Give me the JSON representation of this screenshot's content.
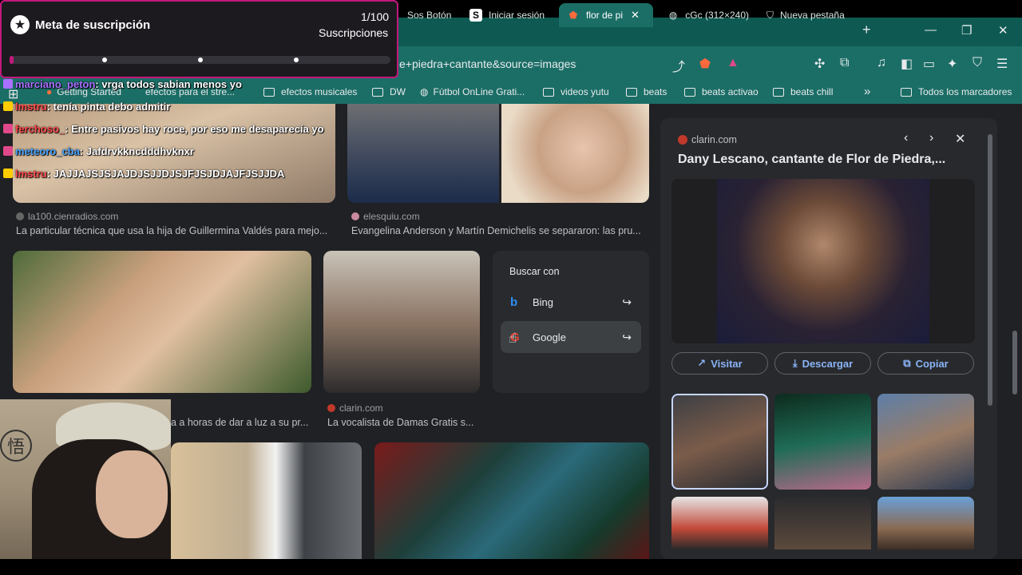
{
  "tabs": [
    {
      "label": "Sos Botón",
      "icon": "tab-favicon-icon"
    },
    {
      "label": "Iniciar sesión",
      "icon": "s-logo-icon"
    },
    {
      "label": "flor de pi",
      "icon": "brave-icon",
      "active": true
    },
    {
      "label": "cGc (312×240)",
      "icon": "globe-icon"
    },
    {
      "label": "Nueva pestaña",
      "icon": "shield-icon"
    }
  ],
  "window": {
    "new_tab": "+",
    "minimize": "—",
    "restore": "❐",
    "close": "✕"
  },
  "address": {
    "url": "e+piedra+cantante&source=images"
  },
  "bookmarks": [
    {
      "label": "Getting Started"
    },
    {
      "label": "efectos para el stre..."
    },
    {
      "label": "efectos musicales"
    },
    {
      "label": "DW"
    },
    {
      "label": "Fútbol OnLine Grati..."
    },
    {
      "label": "videos yutu"
    },
    {
      "label": "beats"
    },
    {
      "label": "beats activao"
    },
    {
      "label": "beats chill"
    },
    {
      "label": "Todos los marcadores"
    }
  ],
  "results": [
    {
      "source": "la100.cienradios.com",
      "caption": "La particular técnica que usa la hija de Guillermina Valdés para mejo..."
    },
    {
      "source": "elesquiu.com",
      "caption": "Evangelina Anderson y Martín Demichelis se separaron: las pru..."
    },
    {
      "source": "clarin.com",
      "caption": "La vocalista de Damas Gratis s..."
    },
    {
      "source": "",
      "caption": "a a horas de dar a luz a su pr..."
    }
  ],
  "search_with": {
    "title": "Buscar con",
    "options": [
      {
        "label": "Bing"
      },
      {
        "label": "Google"
      }
    ]
  },
  "panel": {
    "source": "clarin.com",
    "title": "Dany Lescano, cantante de Flor de Piedra,...",
    "visit": "Visitar",
    "download": "Descargar",
    "copy": "Copiar"
  },
  "goal": {
    "title": "Meta de suscripción",
    "count": "1/100",
    "label": "Suscripciones",
    "progress": 0.01
  },
  "chat": [
    {
      "user": "marciano_peton",
      "text": ": vrga todos sabian menos yo",
      "color": "#a970ff"
    },
    {
      "user": "lmstru",
      "text": ": tenía pinta debo admitir",
      "color": "#ff4b4b"
    },
    {
      "user": "ferchoso_",
      "text": ": Entre pasivos hay roce, por eso me desaparecía yo",
      "color": "#ff4b4b"
    },
    {
      "user": "meteoro_cba",
      "text": ": Jafdrvkkncdddhvknxr",
      "color": "#4aa3ff"
    },
    {
      "user": "lmstru",
      "text": ": JAJJAJSJSJAJDJSJJDJSJFJSJDJAJFJSJJDA",
      "color": "#ff4b4b"
    }
  ]
}
